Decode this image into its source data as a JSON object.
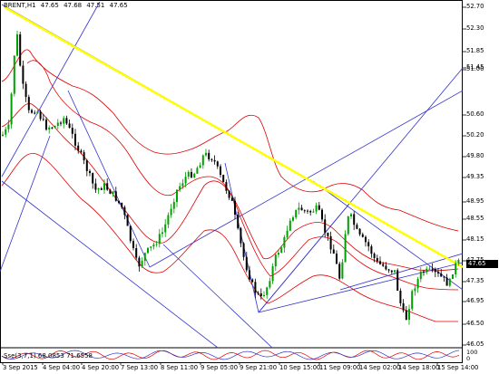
{
  "header": {
    "symbol": "BRENT,H1",
    "ohlc": [
      "47.65",
      "47.68",
      "47.51",
      "47.65"
    ]
  },
  "price_axis": {
    "labels": [
      "52.70",
      "52.30",
      "51.85",
      "51.45",
      "51.00",
      "50.60",
      "50.20",
      "49.80",
      "49.35",
      "48.95",
      "48.55",
      "48.15",
      "47.75",
      "47.35",
      "46.95",
      "46.50",
      "46.05"
    ],
    "current_price": "47.65"
  },
  "time_axis": {
    "labels": [
      "3 Sep 2015",
      "4 Sep 04:00",
      "4 Sep 20:00",
      "7 Sep 13:00",
      "8 Sep 11:00",
      "9 Sep 05:00",
      "9 Sep 21:00",
      "10 Sep 15:00",
      "11 Sep 09:00",
      "14 Sep 02:00",
      "14 Sep 18:00",
      "15 Sep 14:00"
    ]
  },
  "oscillator": {
    "title": "Sse(3,7,1) 68.0853 71.6558",
    "axis_labels": [
      "100",
      "0"
    ]
  },
  "colors": {
    "bull_candle": "#00a000",
    "bear_candle": "#000000",
    "trendline_major": "#ffff00",
    "trendline_minor": "#3333cc",
    "bands": "#e00000"
  }
}
